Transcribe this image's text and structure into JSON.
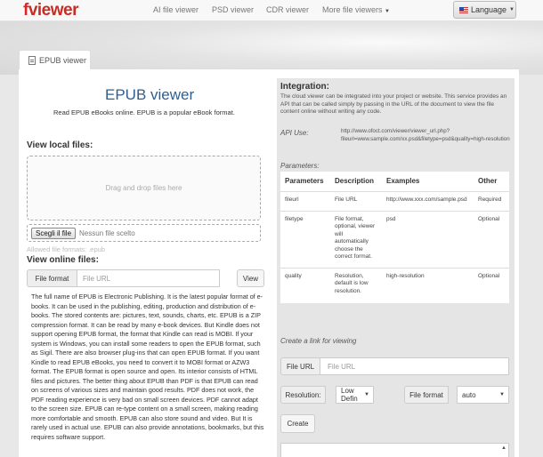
{
  "nav": {
    "logo_first": "f",
    "logo_rest": "viewer",
    "links": [
      "AI file viewer",
      "PSD viewer",
      "CDR viewer",
      "More file viewers"
    ],
    "language": "Language"
  },
  "tab": {
    "label": "EPUB viewer"
  },
  "left": {
    "title": "EPUB viewer",
    "subtitle": "Read EPUB eBooks online. EPUB is a popular eBook format.",
    "local_heading": "View local files:",
    "drop_text": "Drag and drop files here",
    "choose_button": "Scegli il file",
    "no_file": "Nessun file scelto",
    "allowed": "Allowed file formats: .epub",
    "online_heading": "View online files:",
    "file_format_label": "File format",
    "url_placeholder": "File URL",
    "view_button": "View",
    "description": "The full name of EPUB is Electronic Publishing. It is the latest popular format of e-books. It can be used in the publishing, editing, production and distribution of e-books. The stored contents are: pictures, text, sounds, charts, etc. EPUB is a ZIP compression format. It can be read by many e-book devices. But Kindle does not support opening EPUB format, the format that Kindle can read is MOBI. If your system is Windows, you can install some readers to open the EPUB format, such as Sigil. There are also browser plug-ins that can open EPUB format. If you want Kindle to read EPUB eBooks, you need to convert it to MOBI format or AZW3 format. The EPUB format is open source and open. Its interior consists of HTML files and pictures. The better thing about EPUB than PDF is that EPUB can read on screens of various sizes and maintain good results. PDF does not work, the PDF reading experience is very bad on small screen devices. PDF cannot adapt to the screen size. EPUB can re-type content on a small screen, making reading more comfortable and smooth. EPUB can also store sound and video. But It is rarely used in actual use. EPUB can also provide annotations, bookmarks, but this requires software support."
  },
  "right": {
    "integration_heading": "Integration:",
    "integration_text": "The cloud viewer can be integrated into your project or website. This service provides an API that can be called simply by passing in the URL of the document to view the file content online without writing any code.",
    "api_label": "API Use:",
    "api_text": "http://www.ofoct.com/viewer/viewer_url.php?fileurl=www.sample.com/xx.psd&filetype=psd&quality=high-resolution",
    "params_label": "Parameters:",
    "table": {
      "headers": [
        "Parameters",
        "Description",
        "Examples",
        "Other"
      ],
      "rows": [
        [
          "fileurl",
          "File URL",
          "http://www.xxx.com/sample.psd",
          "Required"
        ],
        [
          "filetype",
          "File format, optional, viewer will automatically choose the correct format.",
          "psd",
          "Optional"
        ],
        [
          "quality",
          "Resolution, default is low resolution.",
          "high-resolution",
          "Optional"
        ]
      ]
    },
    "create_label": "Create a link for viewing",
    "fileurl_label": "File URL",
    "fileurl_placeholder": "File URL",
    "resolution_label": "Resolution:",
    "resolution_value": "Low Defin",
    "fileformat_label": "File format",
    "fileformat_value": "auto",
    "create_button": "Create"
  }
}
